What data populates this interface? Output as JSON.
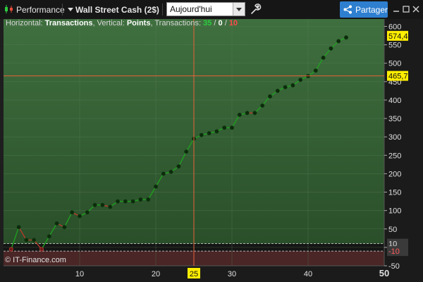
{
  "toolbar": {
    "performance_label": "Performance",
    "instrument_label": "Wall Street Cash (2$)",
    "period_value": "Aujourd'hui",
    "share_label": "Partager"
  },
  "info": {
    "horizontal_label": "Horizontal:",
    "horizontal_value": "Transactions",
    "vertical_label": "Vertical:",
    "vertical_value": "Points",
    "transactions_label": "Transactions:",
    "winners": "35",
    "neutral": "0",
    "losers": "10",
    "slash": "/"
  },
  "copyright": "© IT-Finance.com",
  "colors": {
    "positive_line": "#1ea31e",
    "negative_line": "#c0392b",
    "crosshair": "#e8623a",
    "badge": "#ffee00",
    "positive_bg": "#3a6a3a",
    "negative_bg": "#4a2626"
  },
  "chart_data": {
    "type": "line",
    "x": [
      1,
      2,
      3,
      4,
      5,
      6,
      7,
      8,
      9,
      10,
      11,
      12,
      13,
      14,
      15,
      16,
      17,
      18,
      19,
      20,
      21,
      22,
      23,
      24,
      25,
      26,
      27,
      28,
      29,
      30,
      31,
      32,
      33,
      34,
      35,
      36,
      37,
      38,
      39,
      40,
      41,
      42,
      43,
      44,
      45
    ],
    "y": [
      -5,
      55,
      20,
      20,
      -5,
      30,
      65,
      55,
      95,
      85,
      95,
      115,
      115,
      110,
      125,
      125,
      125,
      130,
      130,
      165,
      200,
      205,
      220,
      260,
      295,
      305,
      310,
      315,
      325,
      325,
      360,
      365,
      365,
      385,
      410,
      425,
      435,
      440,
      455,
      465,
      480,
      515,
      540,
      560,
      570
    ],
    "trade_result": [
      "win",
      "win",
      "loss",
      "loss",
      "loss",
      "win",
      "win",
      "loss",
      "win",
      "loss",
      "win",
      "win",
      "win",
      "loss",
      "win",
      "win",
      "win",
      "win",
      "win",
      "win",
      "win",
      "win",
      "win",
      "win",
      "win",
      "win",
      "win",
      "win",
      "win",
      "win",
      "win",
      "win",
      "loss",
      "win",
      "win",
      "win",
      "win",
      "win",
      "win",
      "win",
      "win",
      "win",
      "win",
      "win",
      "win"
    ],
    "xlim": [
      0,
      50
    ],
    "ylim": [
      -50,
      620
    ],
    "x_ticks": [
      10,
      20,
      30,
      40,
      50
    ],
    "y_ticks": [
      600,
      550,
      500,
      450,
      400,
      350,
      300,
      250,
      200,
      150,
      100,
      50,
      0,
      -50
    ],
    "y_tick_labels": [
      "600",
      "550",
      "500",
      "450",
      "400",
      "350",
      "300",
      "250",
      "200",
      "150",
      "100",
      "50",
      "0",
      "-50"
    ],
    "crosshair_x": 25,
    "crosshair_x_label": "25",
    "crosshair_y": 465.7,
    "crosshair_y_label": "465,7",
    "last_value": 574.4,
    "last_value_label": "574,4",
    "upper_threshold": 10,
    "upper_threshold_label": "10",
    "lower_threshold": -10,
    "lower_threshold_label": "-10",
    "grid": true
  }
}
